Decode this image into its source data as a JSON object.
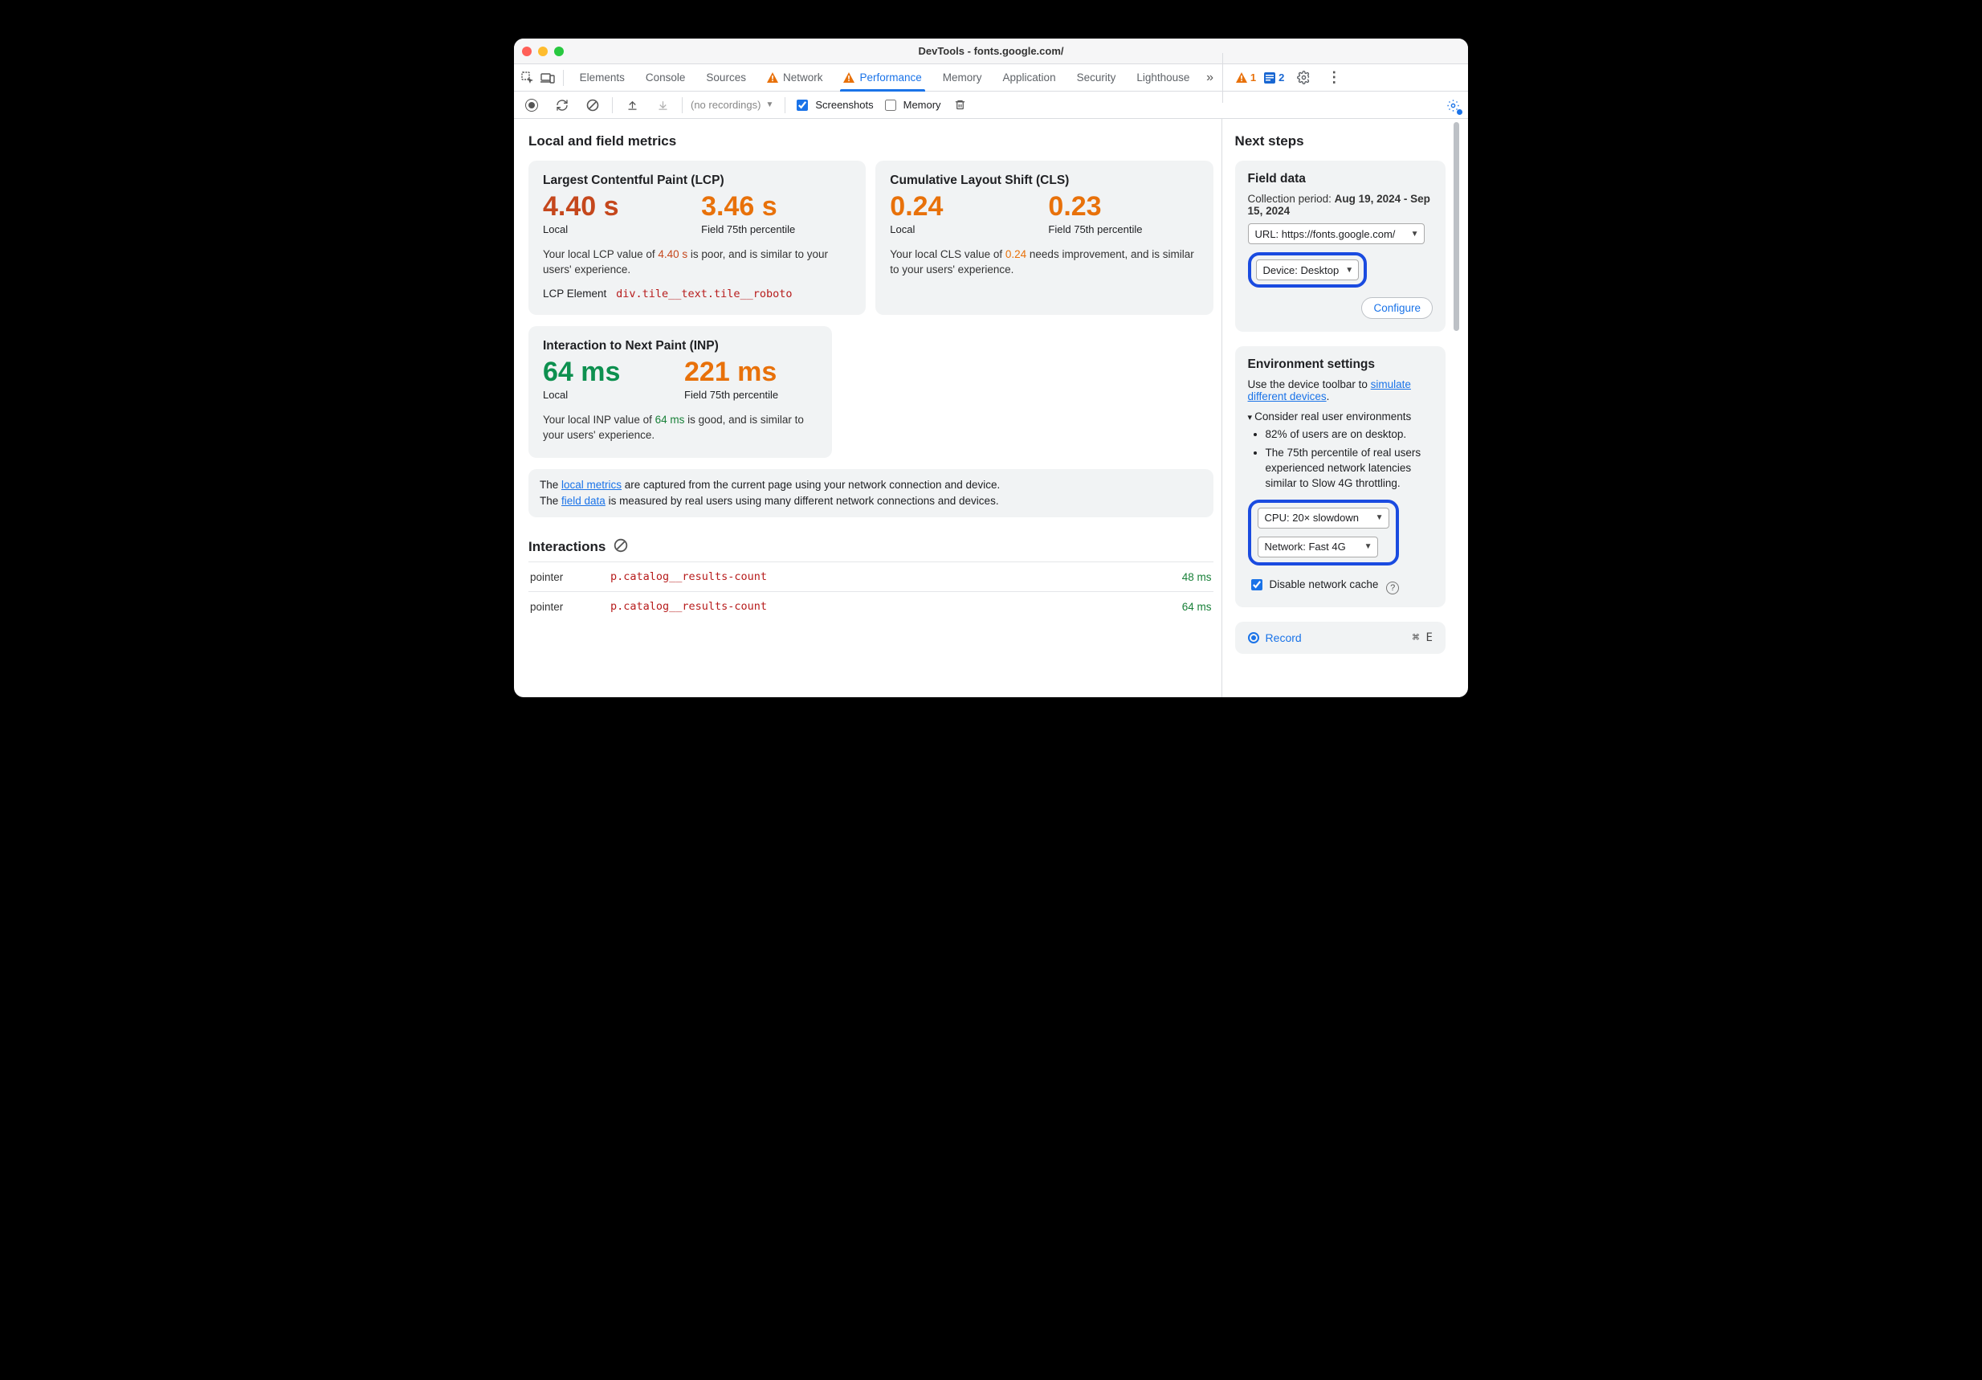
{
  "titlebar": {
    "title": "DevTools - fonts.google.com/"
  },
  "tabs": {
    "elements": "Elements",
    "console": "Console",
    "sources": "Sources",
    "network": "Network",
    "performance": "Performance",
    "memory": "Memory",
    "application": "Application",
    "security": "Security",
    "lighthouse": "Lighthouse",
    "warn_count": "1",
    "info_count": "2"
  },
  "toolbar": {
    "recordings_placeholder": "(no recordings)",
    "screenshots_label": "Screenshots",
    "memory_label": "Memory"
  },
  "left": {
    "heading": "Local and field metrics",
    "lcp": {
      "title": "Largest Contentful Paint (LCP)",
      "local_val": "4.40 s",
      "local_label": "Local",
      "field_val": "3.46 s",
      "field_label": "Field 75th percentile",
      "desc_pre": "Your local LCP value of ",
      "desc_val": "4.40 s",
      "desc_post": " is poor, and is similar to your users' experience.",
      "el_label": "LCP Element",
      "el_sel": "div.tile__text.tile__roboto"
    },
    "cls": {
      "title": "Cumulative Layout Shift (CLS)",
      "local_val": "0.24",
      "local_label": "Local",
      "field_val": "0.23",
      "field_label": "Field 75th percentile",
      "desc_pre": "Your local CLS value of ",
      "desc_val": "0.24",
      "desc_post": " needs improvement, and is similar to your users' experience."
    },
    "inp": {
      "title": "Interaction to Next Paint (INP)",
      "local_val": "64 ms",
      "local_label": "Local",
      "field_val": "221 ms",
      "field_label": "Field 75th percentile",
      "desc_pre": "Your local INP value of ",
      "desc_val": "64 ms",
      "desc_post": " is good, and is similar to your users' experience."
    },
    "note": {
      "line1_pre": "The ",
      "line1_link": "local metrics",
      "line1_post": " are captured from the current page using your network connection and device.",
      "line2_pre": "The ",
      "line2_link": "field data",
      "line2_post": " is measured by real users using many different network connections and devices."
    },
    "interactions": {
      "heading": "Interactions",
      "rows": [
        {
          "type": "pointer",
          "selector": "p.catalog__results-count",
          "ms": "48 ms"
        },
        {
          "type": "pointer",
          "selector": "p.catalog__results-count",
          "ms": "64 ms"
        }
      ]
    }
  },
  "right": {
    "heading": "Next steps",
    "field": {
      "title": "Field data",
      "period_label": "Collection period: ",
      "period_value": "Aug 19, 2024 - Sep 15, 2024",
      "url_select": "URL: https://fonts.google.com/",
      "device_select": "Device: Desktop",
      "configure": "Configure"
    },
    "env": {
      "title": "Environment settings",
      "desc_pre": "Use the device toolbar to ",
      "desc_link": "simulate different devices",
      "desc_post": ".",
      "summary": "Consider real user environments",
      "bullet1": "82% of users are on desktop.",
      "bullet2": "The 75th percentile of real users experienced network latencies similar to Slow 4G throttling.",
      "cpu_select": "CPU: 20× slowdown",
      "net_select": "Network: Fast 4G",
      "disable_cache": "Disable network cache"
    },
    "record": {
      "label": "Record",
      "shortcut": "⌘ E"
    }
  }
}
